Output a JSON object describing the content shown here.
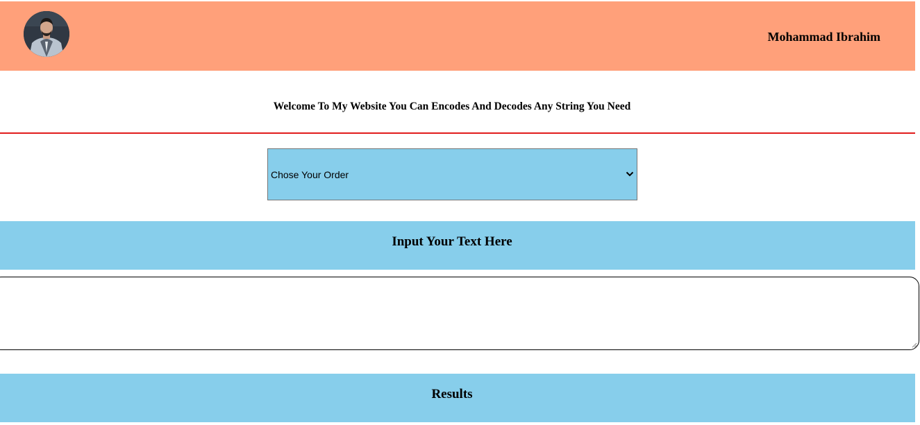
{
  "header": {
    "avatar_alt": "profile photo",
    "owner_name": "Mohammad Ibrahim"
  },
  "intro": {
    "welcome_text": "Welcome To My Website You Can Encodes And Decodes Any String You Need"
  },
  "order_select": {
    "selected_label": "Chose Your Order",
    "icon": "chevron-down-icon"
  },
  "input_section": {
    "title": "Input Your Text Here",
    "value": "",
    "placeholder": ""
  },
  "results_section": {
    "title": "Results"
  },
  "colors": {
    "header_bg": "#ffa07a",
    "band_bg": "#87ceeb",
    "divider": "#e11b1b",
    "text": "#000000"
  }
}
